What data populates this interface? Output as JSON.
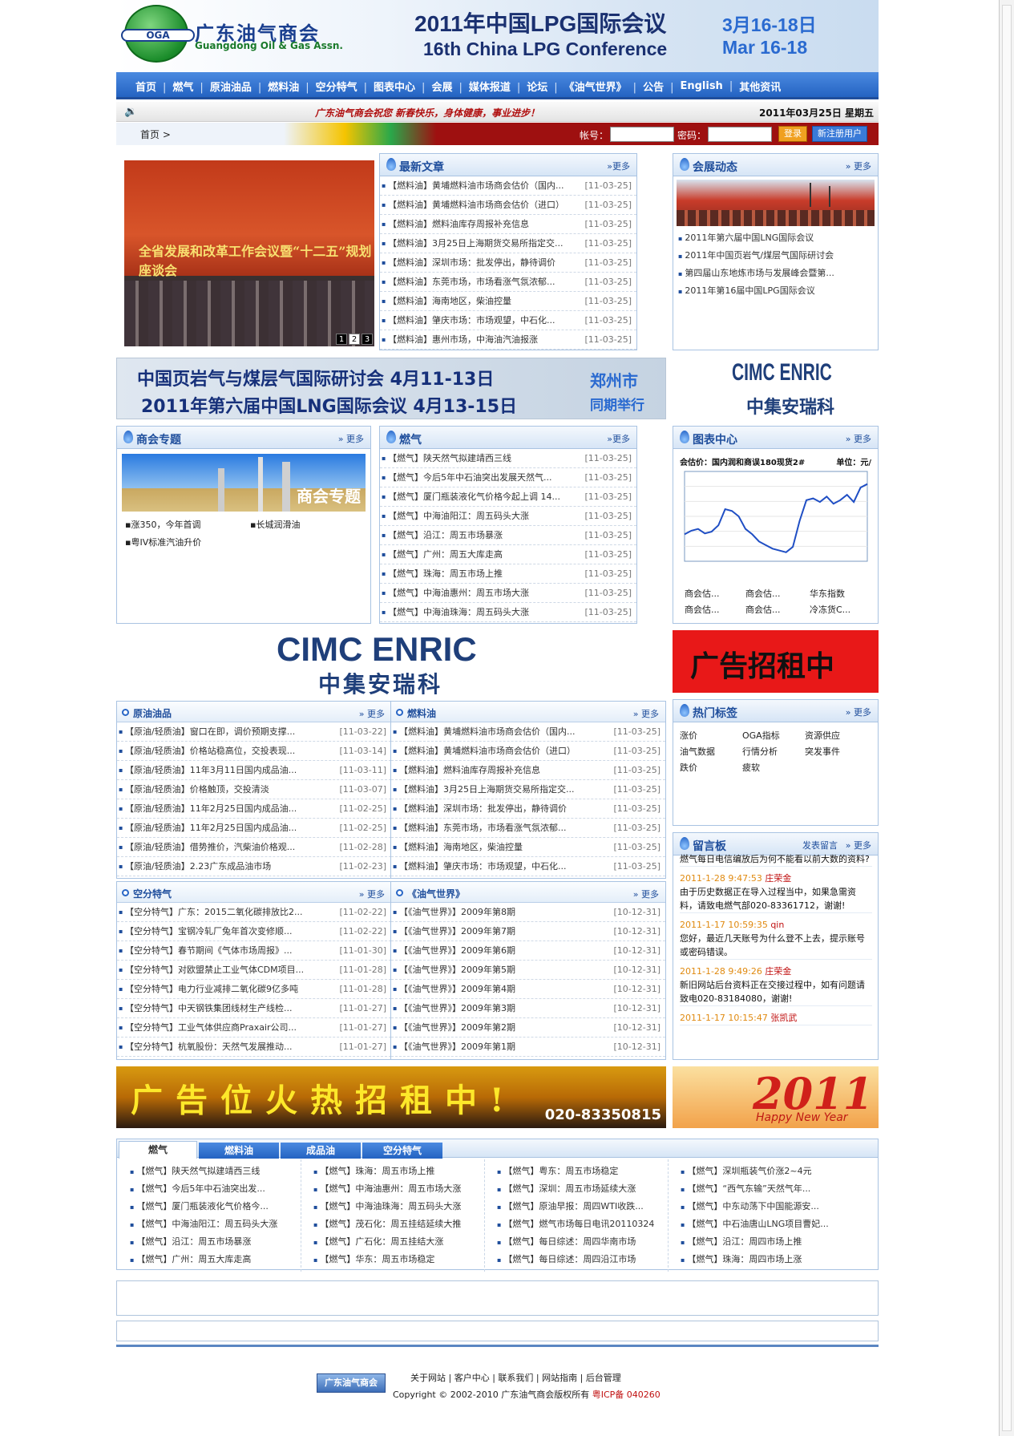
{
  "header": {
    "logo_bar": "OGA",
    "logo_cn": "广东油气商会",
    "logo_en": "Guangdong Oil & Gas Assn.",
    "conf_cn": "2011年中国LPG国际会议",
    "conf_en": "16th China LPG Conference",
    "conf_date_cn": "3月16-18日",
    "conf_date_en": "Mar  16-18"
  },
  "nav": [
    "首页",
    "燃气",
    "原油油品",
    "燃料油",
    "空分特气",
    "图表中心",
    "会展",
    "媒体报道",
    "论坛",
    "《油气世界》",
    "公告",
    "English",
    "其他资讯"
  ],
  "notice": {
    "message": "广东油气商会祝您  新春快乐，身体健康，事业进步！",
    "date": "2011年03月25日  星期五"
  },
  "login": {
    "breadcrumb": "首页  >",
    "account_label": "帐号：",
    "password_label": "密码：",
    "login_button": "登录",
    "register_button": "新注册用户"
  },
  "more": "更多",
  "photo": {
    "caption": "全省发展和改革工作会议暨“十二五”规划座谈会",
    "pages": [
      "1",
      "2",
      "3"
    ]
  },
  "latest": {
    "title": "最新文章",
    "items": [
      {
        "t": "【燃料油】黄埔燃料油市场商会估价（国内...",
        "d": "[11-03-25]"
      },
      {
        "t": "【燃料油】黄埔燃料油市场商会估价（进口）",
        "d": "[11-03-25]"
      },
      {
        "t": "【燃料油】燃料油库存周报补充信息",
        "d": "[11-03-25]"
      },
      {
        "t": "【燃料油】3月25日上海期货交易所指定交...",
        "d": "[11-03-25]"
      },
      {
        "t": "【燃料油】深圳市场：批发停出，静待调价",
        "d": "[11-03-25]"
      },
      {
        "t": "【燃料油】东莞市场，市场看涨气氛浓郁...",
        "d": "[11-03-25]"
      },
      {
        "t": "【燃料油】海南地区，柴油控量",
        "d": "[11-03-25]"
      },
      {
        "t": "【燃料油】肇庆市场：市场观望，中石化...",
        "d": "[11-03-25]"
      },
      {
        "t": "【燃料油】惠州市场，中海油汽油报涨",
        "d": "[11-03-25]"
      }
    ]
  },
  "expo": {
    "title": "会展动态",
    "items": [
      "2011年第六届中国LNG国际会议",
      "2011年中国页岩气/煤层气国际研讨会",
      "第四届山东地炼市场与发展峰会暨第...",
      "2011年第16届中国LPG国际会议"
    ]
  },
  "ad1": {
    "line1": "中国页岩气与煤层气国际研讨会    4月11-13日",
    "line2": "2011年第六届中国LNG国际会议    4月13-15日",
    "city": "郑州市",
    "same": "同期举行"
  },
  "cimc": {
    "en": "CIMC ENRIC",
    "cn": "中集安瑞科"
  },
  "topic": {
    "title": "商会专题",
    "img_text": "商会专题",
    "items": [
      "涨350，今年首调",
      "长城润滑油",
      "粤IV标准汽油升价"
    ]
  },
  "gas": {
    "title": "燃气",
    "items": [
      {
        "t": "【燃气】陕天然气拟建靖西三线",
        "d": "[11-03-25]"
      },
      {
        "t": "【燃气】今后5年中石油突出发展天然气...",
        "d": "[11-03-25]"
      },
      {
        "t": "【燃气】厦门瓶装液化气价格今起上调 14...",
        "d": "[11-03-25]"
      },
      {
        "t": "【燃气】中海油阳江：周五码头大涨",
        "d": "[11-03-25]"
      },
      {
        "t": "【燃气】沿江：周五市场暴涨",
        "d": "[11-03-25]"
      },
      {
        "t": "【燃气】广州：周五大库走高",
        "d": "[11-03-25]"
      },
      {
        "t": "【燃气】珠海：周五市场上推",
        "d": "[11-03-25]"
      },
      {
        "t": "【燃气】中海油惠州：周五市场大涨",
        "d": "[11-03-25]"
      },
      {
        "t": "【燃气】中海油珠海：周五码头大涨",
        "d": "[11-03-25]"
      }
    ]
  },
  "chartbox": {
    "title": "图表中心",
    "chart_title": "会估价：国内润和商误180现货2#",
    "unit": "单位：元/",
    "links": [
      "商会估...",
      "商会估...",
      "华东指数",
      "商会估...",
      "商会估...",
      "冷冻货C..."
    ]
  },
  "chart_data": {
    "type": "line",
    "title": "会估价：国内润和商误180现货2#",
    "ylabel": "单位：元/",
    "series": [
      {
        "values": [
          0.3,
          0.34,
          0.36,
          0.31,
          0.33,
          0.4,
          0.58,
          0.56,
          0.5,
          0.36,
          0.3,
          0.22,
          0.18,
          0.14,
          0.12,
          0.1,
          0.16,
          0.45,
          0.68,
          0.7,
          0.66,
          0.72,
          0.64,
          0.68,
          0.74,
          0.66,
          0.82,
          0.86
        ]
      }
    ],
    "grid": true
  },
  "ad_rent": "广告招租中",
  "crude": {
    "title": "原油油品",
    "items": [
      {
        "t": "【原油/轻质油】窗口在即，调价预期支撑...",
        "d": "[11-03-22]"
      },
      {
        "t": "【原油/轻质油】价格站稳高位，交投表现...",
        "d": "[11-03-14]"
      },
      {
        "t": "【原油/轻质油】11年3月11日国内成品油...",
        "d": "[11-03-11]"
      },
      {
        "t": "【原油/轻质油】价格触顶，交投清淡",
        "d": "[11-03-07]"
      },
      {
        "t": "【原油/轻质油】11年2月25日国内成品油...",
        "d": "[11-02-25]"
      },
      {
        "t": "【原油/轻质油】11年2月25日国内成品油...",
        "d": "[11-02-25]"
      },
      {
        "t": "【原油/轻质油】借势推价，汽柴油价格观...",
        "d": "[11-02-28]"
      },
      {
        "t": "【原油/轻质油】2.23广东成品油市场",
        "d": "[11-02-23]"
      }
    ]
  },
  "fuel": {
    "title": "燃料油",
    "items": [
      {
        "t": "【燃料油】黄埔燃料油市场商会估价（国内...",
        "d": "[11-03-25]"
      },
      {
        "t": "【燃料油】黄埔燃料油市场商会估价（进口）",
        "d": "[11-03-25]"
      },
      {
        "t": "【燃料油】燃料油库存周报补充信息",
        "d": "[11-03-25]"
      },
      {
        "t": "【燃料油】3月25日上海期货交易所指定交...",
        "d": "[11-03-25]"
      },
      {
        "t": "【燃料油】深圳市场：批发停出，静待调价",
        "d": "[11-03-25]"
      },
      {
        "t": "【燃料油】东莞市场，市场看涨气氛浓郁...",
        "d": "[11-03-25]"
      },
      {
        "t": "【燃料油】海南地区，柴油控量",
        "d": "[11-03-25]"
      },
      {
        "t": "【燃料油】肇庆市场：市场观望，中石化...",
        "d": "[11-03-25]"
      }
    ]
  },
  "tags": {
    "title": "热门标签",
    "items": [
      "涨价",
      "OGA指标",
      "资源供应",
      "油气数据",
      "行情分析",
      "突发事件",
      "跌价",
      "疲软"
    ]
  },
  "air": {
    "title": "空分特气",
    "items": [
      {
        "t": "【空分特气】广东：2015二氧化碳排放比2...",
        "d": "[11-02-22]"
      },
      {
        "t": "【空分特气】宝钢冷轧厂兔年首次变修顺...",
        "d": "[11-02-22]"
      },
      {
        "t": "【空分特气】春节期间《气体市场周报》...",
        "d": "[11-01-30]"
      },
      {
        "t": "【空分特气】对欧盟禁止工业气体CDM项目...",
        "d": "[11-01-28]"
      },
      {
        "t": "【空分特气】电力行业减排二氧化碳9亿多吨",
        "d": "[11-01-28]"
      },
      {
        "t": "【空分特气】中天钢铁集团线材生产线检...",
        "d": "[11-01-27]"
      },
      {
        "t": "【空分特气】工业气体供应商Praxair公司...",
        "d": "[11-01-27]"
      },
      {
        "t": "【空分特气】杭氧股份：天然气发展推动...",
        "d": "[11-01-27]"
      }
    ]
  },
  "world": {
    "title": "《油气世界》",
    "items": [
      {
        "t": "【《油气世界》】2009年第8期",
        "d": "[10-12-31]"
      },
      {
        "t": "【《油气世界》】2009年第7期",
        "d": "[10-12-31]"
      },
      {
        "t": "【《油气世界》】2009年第6期",
        "d": "[10-12-31]"
      },
      {
        "t": "【《油气世界》】2009年第5期",
        "d": "[10-12-31]"
      },
      {
        "t": "【《油气世界》】2009年第4期",
        "d": "[10-12-31]"
      },
      {
        "t": "【《油气世界》】2009年第3期",
        "d": "[10-12-31]"
      },
      {
        "t": "【《油气世界》】2009年第2期",
        "d": "[10-12-31]"
      },
      {
        "t": "【《油气世界》】2009年第1期",
        "d": "[10-12-31]"
      }
    ]
  },
  "guestbook": {
    "title": "留言板",
    "post": "发表留言",
    "entries": [
      {
        "meta": "",
        "text": "燃气每日电信编放后为何不能看以前大数的资料?",
        "name": ""
      },
      {
        "meta": "2011-1-28 9:47:53",
        "name": "庄荣金",
        "text": "由于历史数据正在导入过程当中，如果急需资料，请致电燃气部020-83361712，谢谢!"
      },
      {
        "meta": "2011-1-17 10:59:35",
        "name": "qin",
        "text": "您好，最近几天账号为什么登不上去，提示账号或密码错误。"
      },
      {
        "meta": "2011-1-28 9:49:26",
        "name": "庄荣金",
        "text": "新旧网站后台资料正在交接过程中，如有问题请致电020-83184080，谢谢!"
      },
      {
        "meta": "2011-1-17 10:15:47",
        "name": "张凯武",
        "text": ""
      }
    ]
  },
  "ad_fire": {
    "text": "广告位火热招租中!",
    "phone": "020-83350815"
  },
  "ad_2011": {
    "year": "2011",
    "greet": "Happy New Year"
  },
  "tabs": [
    "燃气",
    "燃料油",
    "成品油",
    "空分特气"
  ],
  "tabcols": [
    [
      "【燃气】陕天然气拟建靖西三线",
      "【燃气】今后5年中石油突出发...",
      "【燃气】厦门瓶装液化气价格今...",
      "【燃气】中海油阳江：周五码头大涨",
      "【燃气】沿江：周五市场暴涨",
      "【燃气】广州：周五大库走高"
    ],
    [
      "【燃气】珠海：周五市场上推",
      "【燃气】中海油惠州：周五市场大涨",
      "【燃气】中海油珠海：周五码头大涨",
      "【燃气】茂石化：周五挂结延续大推",
      "【燃气】广石化：周五挂结大涨",
      "【燃气】华东：周五市场稳定"
    ],
    [
      "【燃气】粤东：周五市场稳定",
      "【燃气】深圳：周五市场延续大涨",
      "【燃气】原油早报：周四WTI收跌...",
      "【燃气】燃气市场每日电讯20110324",
      "【燃气】每日综述：周四华南市场",
      "【燃气】每日综述：周四沿江市场"
    ],
    [
      "【燃气】深圳瓶装气价涨2~4元",
      "【燃气】“西气东输”天然气年...",
      "【燃气】中东动荡下中国能源安...",
      "【燃气】中石油唐山LNG项目曹妃...",
      "【燃气】沿江：周四市场上推",
      "【燃气】珠海：周四市场上涨"
    ]
  ],
  "footer": {
    "badge": "广东油气商会",
    "links": [
      "关于网站",
      "客户中心",
      "联系我们",
      "网站指南",
      "后台管理"
    ],
    "copyright": "Copyright © 2002-2010   广东油气商会版权所有",
    "icp": "粤ICP备  040260"
  }
}
